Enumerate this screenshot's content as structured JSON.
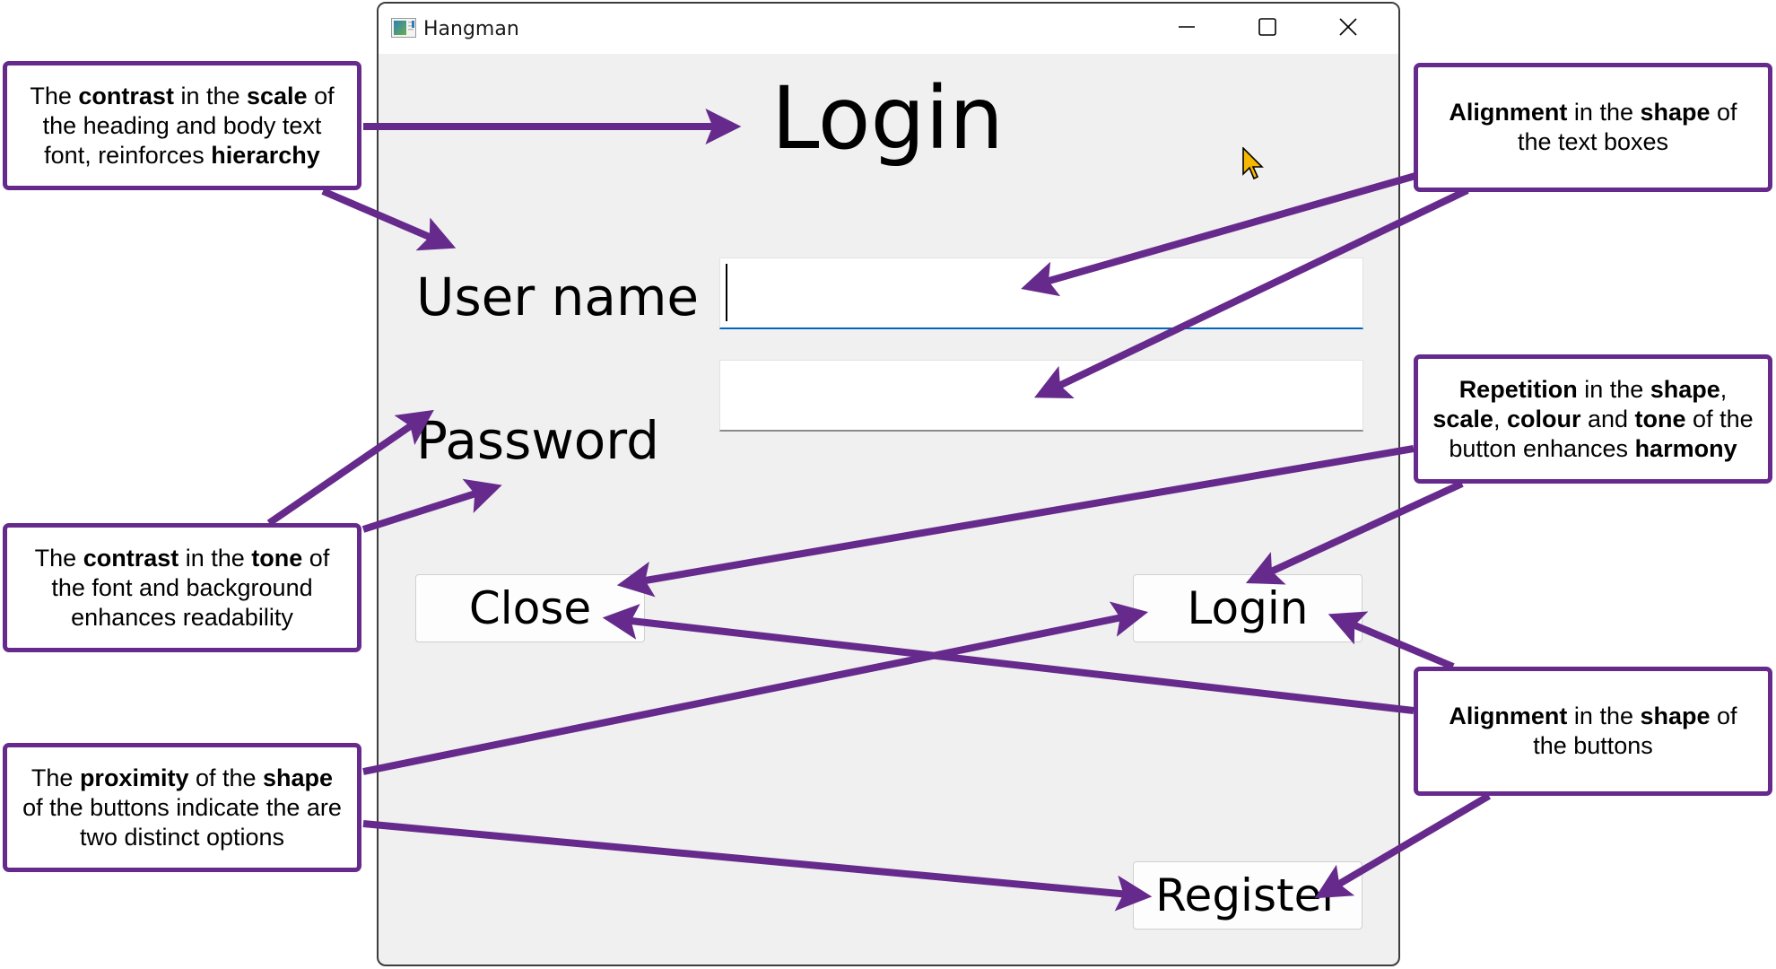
{
  "window": {
    "title": "Hangman",
    "app_icon": "app-window-icon",
    "controls": [
      "minimize-icon",
      "maximize-icon",
      "close-icon"
    ]
  },
  "form": {
    "heading": "Login",
    "username_label": "User name",
    "username_value": "",
    "password_label": "Password",
    "password_value": "",
    "buttons": {
      "close": "Close",
      "login": "Login",
      "register": "Register"
    }
  },
  "annotations": [
    {
      "id": "n1",
      "parts": [
        [
          "The ",
          false
        ],
        [
          "contrast",
          true
        ],
        [
          " in the ",
          false
        ],
        [
          "scale",
          true
        ],
        [
          " of the heading and body text font, reinforces ",
          false
        ],
        [
          "hierarchy",
          true
        ]
      ]
    },
    {
      "id": "n2",
      "parts": [
        [
          "Alignment",
          true
        ],
        [
          " in the ",
          false
        ],
        [
          "shape",
          true
        ],
        [
          " of the text boxes",
          false
        ]
      ]
    },
    {
      "id": "n3",
      "parts": [
        [
          "Repetition",
          true
        ],
        [
          " in the ",
          false
        ],
        [
          "shape",
          true
        ],
        [
          ", ",
          false
        ],
        [
          "scale",
          true
        ],
        [
          ", ",
          false
        ],
        [
          "colour",
          true
        ],
        [
          " and ",
          false
        ],
        [
          "tone",
          true
        ],
        [
          " of the button enhances ",
          false
        ],
        [
          "harmony",
          true
        ]
      ]
    },
    {
      "id": "n4",
      "parts": [
        [
          "The ",
          false
        ],
        [
          "contrast",
          true
        ],
        [
          " in the ",
          false
        ],
        [
          "tone",
          true
        ],
        [
          " of the font and background enhances readability",
          false
        ]
      ]
    },
    {
      "id": "n5",
      "parts": [
        [
          "The ",
          false
        ],
        [
          "proximity",
          true
        ],
        [
          " of the ",
          false
        ],
        [
          "shape",
          true
        ],
        [
          " of the buttons indicate the are two distinct options",
          false
        ]
      ]
    },
    {
      "id": "n6",
      "parts": [
        [
          "Alignment",
          true
        ],
        [
          " in the ",
          false
        ],
        [
          "shape",
          true
        ],
        [
          " of the buttons",
          false
        ]
      ]
    }
  ],
  "colors": {
    "annotation": "#662a8c",
    "focus_underline": "#0067c0",
    "window_bg": "#f0f0f0",
    "cursor": "#f5b800"
  }
}
